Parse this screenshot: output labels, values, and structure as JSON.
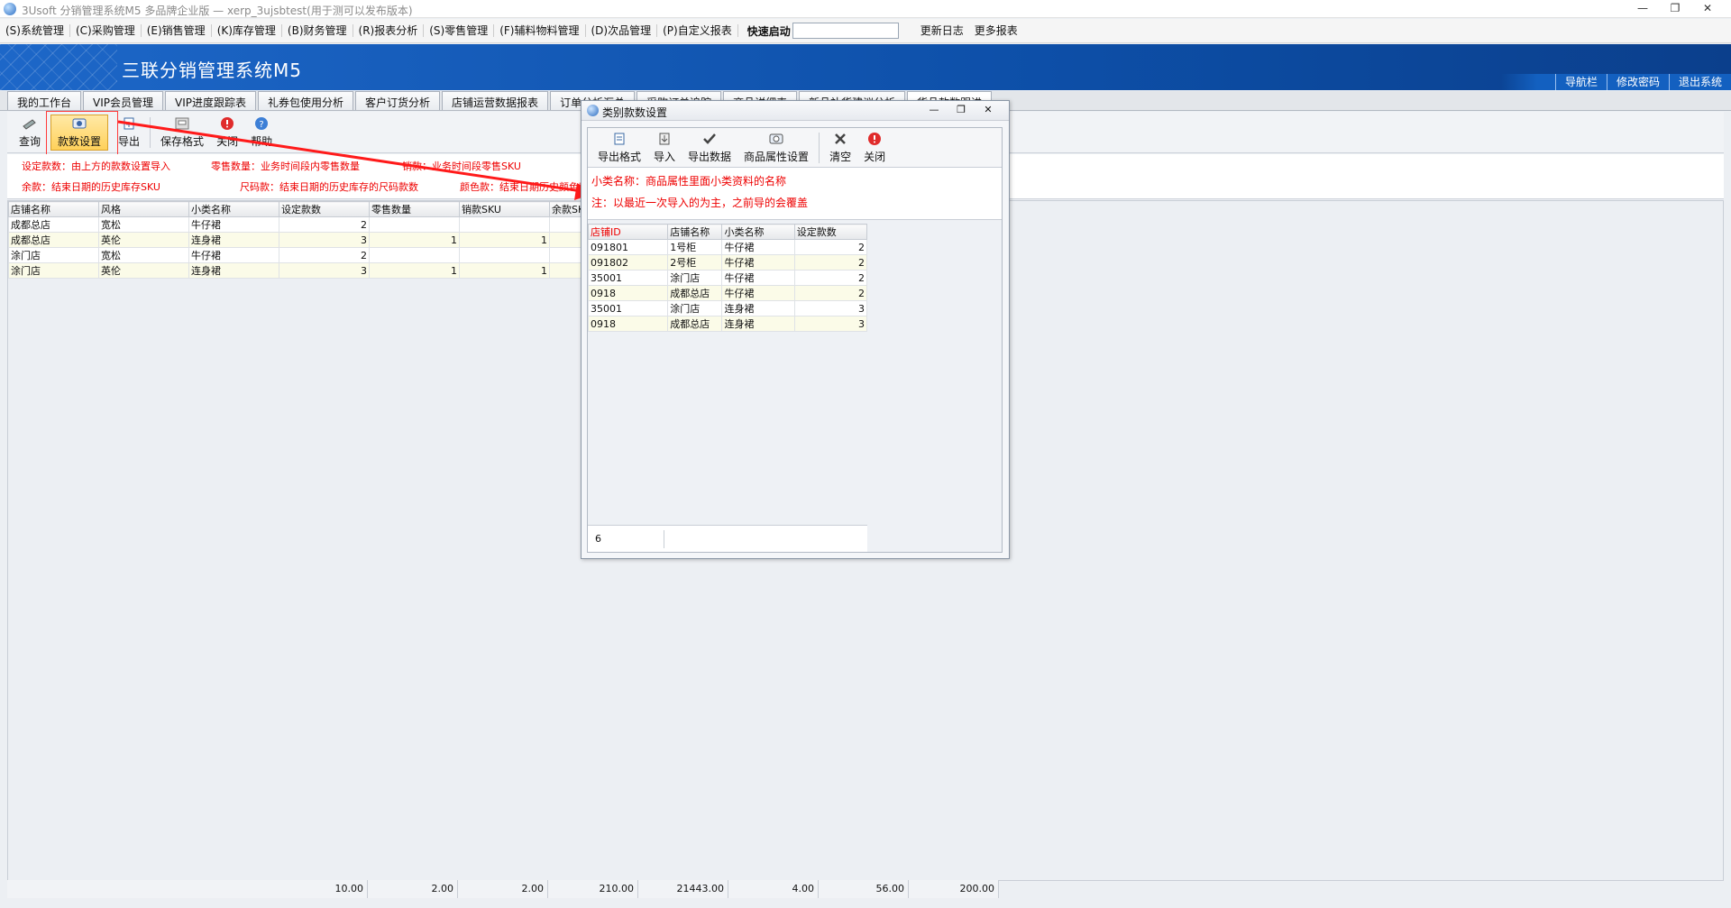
{
  "window": {
    "title": "3Usoft 分销管理系统M5 多品牌企业版 — xerp_3ujsbtest(用于测可以发布版本)",
    "controls": [
      "—",
      "❐",
      "✕"
    ]
  },
  "menu": [
    "(S)系统管理",
    "(C)采购管理",
    "(E)销售管理",
    "(K)库存管理",
    "(B)财务管理",
    "(R)报表分析",
    "(S)零售管理",
    "(F)辅料物料管理",
    "(D)次品管理",
    "(P)自定义报表"
  ],
  "quick_start_label": "快速启动",
  "quick_start_value": "",
  "extra_menu": [
    "更新日志",
    "更多报表"
  ],
  "banner": {
    "title": "三联分销管理系统M5",
    "links": [
      "导航栏",
      "修改密码",
      "退出系统"
    ]
  },
  "tabs": [
    "我的工作台",
    "VIP会员管理",
    "VIP进度跟踪表",
    "礼券包使用分析",
    "客户订货分析",
    "店铺运营数据报表",
    "订单分析汇总",
    "采购订单追踪",
    "商品详细表",
    "新品补货建议分析",
    "货品款数跟进"
  ],
  "toolbar": [
    "查询",
    "款数设置",
    "导出",
    "保存格式",
    "关闭",
    "帮助"
  ],
  "hints": [
    "设定款数：由上方的款数设置导入",
    "零售数量：业务时间段内零售数量",
    "销款：业务时间段零售SKU",
    "余款：结束日期的历史库存SKU",
    "尺码款：结束日期的历史库存的尺码款数",
    "颜色款：结束日期历史颜色款数"
  ],
  "grid": {
    "columns": [
      "店铺名称",
      "风格",
      "小类名称",
      "设定款数",
      "零售数量",
      "销款SKU",
      "余款SKU"
    ],
    "rows": [
      [
        "成都总店",
        "宽松",
        "牛仔裙",
        "2",
        "",
        "",
        ""
      ],
      [
        "成都总店",
        "英伦",
        "连身裙",
        "3",
        "1",
        "1",
        ""
      ],
      [
        "涂门店",
        "宽松",
        "牛仔裙",
        "2",
        "",
        "",
        ""
      ],
      [
        "涂门店",
        "英伦",
        "连身裙",
        "3",
        "1",
        "1",
        ""
      ]
    ],
    "totals": [
      "10.00",
      "2.00",
      "2.00",
      "210.00",
      "21443.00",
      "4.00",
      "56.00",
      "200.00"
    ]
  },
  "dialog": {
    "title": "类别款数设置",
    "controls": [
      "—",
      "❐",
      "✕"
    ],
    "toolbar": [
      "导出格式",
      "导入",
      "导出数据",
      "商品属性设置",
      "清空",
      "关闭"
    ],
    "notes": [
      "小类名称：商品属性里面小类资料的名称",
      "注：以最近一次导入的为主，之前导的会覆盖"
    ],
    "columns": [
      "店铺ID",
      "店铺名称",
      "小类名称",
      "设定款数"
    ],
    "rows": [
      [
        "091801",
        "1号柜",
        "牛仔裙",
        "2"
      ],
      [
        "091802",
        "2号柜",
        "牛仔裙",
        "2"
      ],
      [
        "35001",
        "涂门店",
        "牛仔裙",
        "2"
      ],
      [
        "0918",
        "成都总店",
        "牛仔裙",
        "2"
      ],
      [
        "35001",
        "涂门店",
        "连身裙",
        "3"
      ],
      [
        "0918",
        "成都总店",
        "连身裙",
        "3"
      ]
    ],
    "row_count": "6"
  },
  "colors": {
    "banner": "#0d4fa8",
    "highlight": "#ffd15a",
    "annotation": "#ff0000"
  }
}
